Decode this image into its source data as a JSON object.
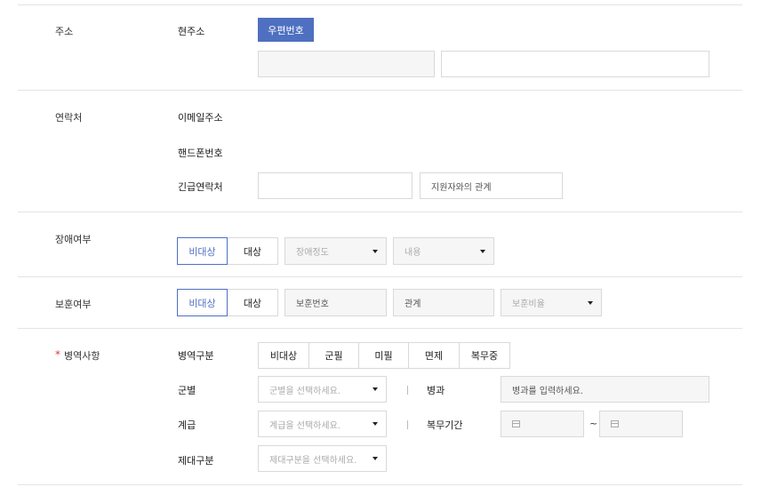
{
  "address": {
    "label": "주소",
    "current_label": "현주소",
    "postcode_button": "우편번호",
    "line1_value": "",
    "line2_value": ""
  },
  "contact": {
    "label": "연락처",
    "email_label": "이메일주소",
    "phone_label": "핸드폰번호",
    "emergency_label": "긴급연락처",
    "emergency_value": "",
    "relation_placeholder": "지원자와의 관계"
  },
  "disability": {
    "label": "장애여부",
    "option_not": "비대상",
    "option_target": "대상",
    "selected": "비대상",
    "grade_select": "장애정도",
    "content_select": "내용"
  },
  "veteran": {
    "label": "보훈여부",
    "option_not": "비대상",
    "option_target": "대상",
    "selected": "비대상",
    "number_field": "보훈번호",
    "relation_field": "관계",
    "ratio_select": "보훈비율"
  },
  "military": {
    "required_mark": "*",
    "label": "병역사항",
    "type_label": "병역구분",
    "types": [
      "비대상",
      "군필",
      "미필",
      "면제",
      "복무중"
    ],
    "branch_label": "군별",
    "branch_select": "군별을 선택하세요.",
    "specialty_label": "병과",
    "specialty_placeholder": "병과를 입력하세요.",
    "rank_label": "계급",
    "rank_select": "계급을 선택하세요.",
    "period_label": "복무기간",
    "period_separator": "~",
    "discharge_label": "제대구분",
    "discharge_select": "제대구분을 선택하세요."
  },
  "colors": {
    "accent": "#4f70c1",
    "required": "#e03c3c",
    "border": "#d9d9d9",
    "disabled_bg": "#f6f6f6"
  }
}
